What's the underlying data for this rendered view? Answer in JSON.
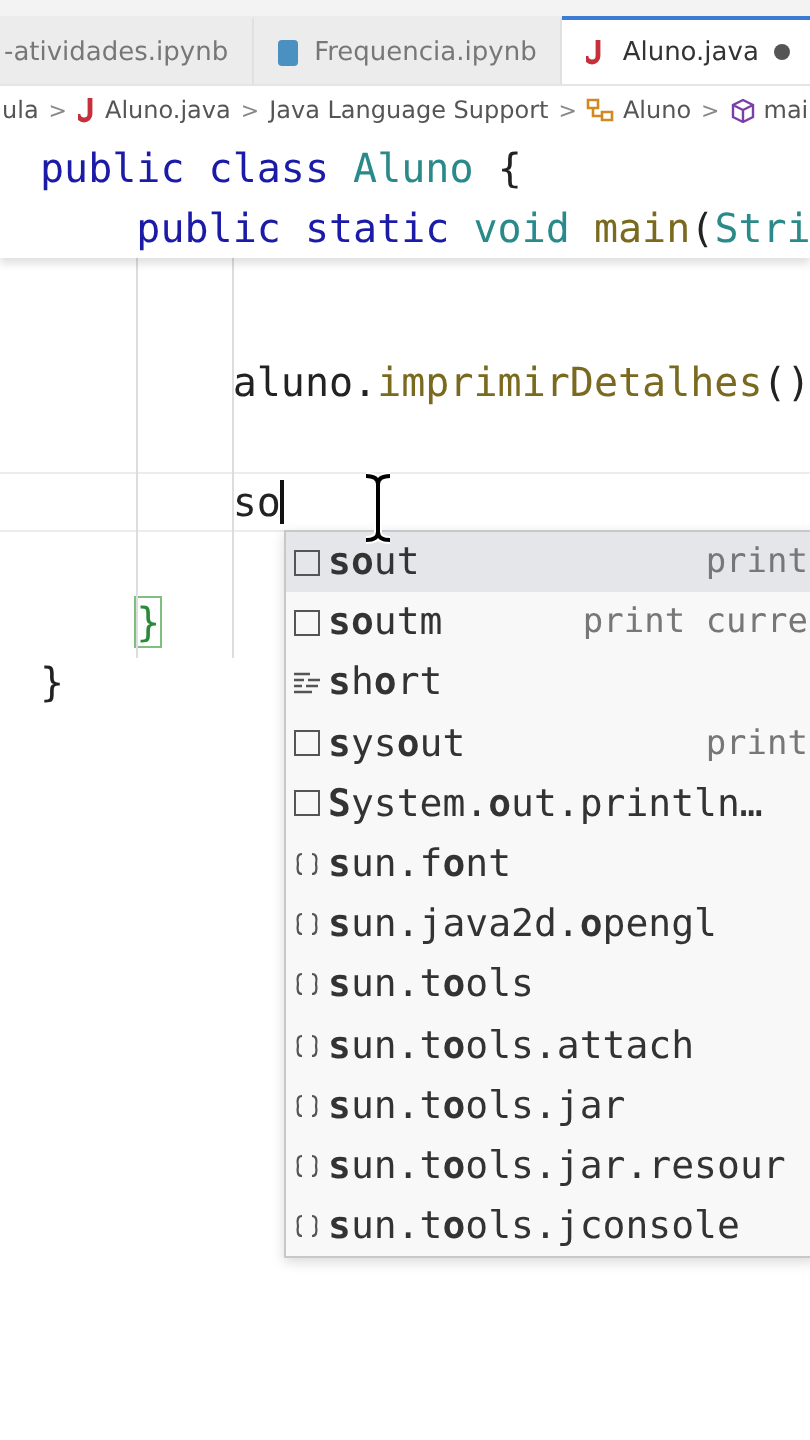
{
  "tabs": [
    {
      "label": "-atividades.ipynb",
      "kind": "plain",
      "selected": false,
      "modified": false
    },
    {
      "label": "Frequencia.ipynb",
      "kind": "notebook",
      "selected": false,
      "modified": false
    },
    {
      "label": "Aluno.java",
      "kind": "java",
      "selected": true,
      "modified": true
    }
  ],
  "breadcrumbs": [
    {
      "label": "ula",
      "kind": "plain"
    },
    {
      "separator": ">",
      "label": "Aluno.java",
      "kind": "java"
    },
    {
      "separator": ">",
      "label": "Java Language Support",
      "kind": "plain"
    },
    {
      "separator": ">",
      "label": "Aluno",
      "kind": "class"
    },
    {
      "separator": ">",
      "label": "mai",
      "kind": "method"
    }
  ],
  "sticky_lines": [
    {
      "tokens": [
        {
          "text": "public class ",
          "kind": "keyword"
        },
        {
          "text": "Aluno",
          "kind": "type"
        },
        {
          "text": " {",
          "kind": "plain"
        }
      ]
    },
    {
      "tokens": [
        {
          "text": "    public static ",
          "kind": "keyword"
        },
        {
          "text": "void ",
          "kind": "type"
        },
        {
          "text": "main",
          "kind": "method"
        },
        {
          "text": "(",
          "kind": "plain"
        },
        {
          "text": "Stri",
          "kind": "type"
        }
      ]
    }
  ],
  "code_lines": [
    {
      "kind": "normal"
    },
    {
      "kind": "normal",
      "tokens": [
        {
          "text": "        aluno.",
          "kind": "plain"
        },
        {
          "text": "imprimirDetalhes",
          "kind": "method"
        },
        {
          "text": "()",
          "kind": "plain"
        }
      ]
    },
    {
      "kind": "normal"
    },
    {
      "kind": "current",
      "tokens": [
        {
          "text": "        so",
          "kind": "plain"
        }
      ]
    },
    {
      "kind": "normal"
    },
    {
      "kind": "normal",
      "tokens": [
        {
          "text": "    }",
          "kind": "match"
        }
      ]
    },
    {
      "kind": "normal",
      "tokens": [
        {
          "text": "}",
          "kind": "plain"
        }
      ]
    }
  ],
  "suggestions": [
    {
      "kind": "snippet",
      "label": "**so**ut",
      "detail": "print",
      "selected": true
    },
    {
      "kind": "snippet",
      "label": "**so**utm",
      "detail": "print curre",
      "selected": false
    },
    {
      "kind": "keyword",
      "label": "**s**h**o**rt",
      "selected": false
    },
    {
      "kind": "snippet",
      "label": "**s**ys**o**ut",
      "detail": "print",
      "selected": false
    },
    {
      "kind": "snippet",
      "label": "**S**ystem.**o**ut.println…",
      "selected": false
    },
    {
      "kind": "module",
      "label": "**s**un.f**o**nt",
      "selected": false
    },
    {
      "kind": "module",
      "label": "**s**un.java2d.**o**pengl",
      "selected": false
    },
    {
      "kind": "module",
      "label": "**s**un.t**o**ols",
      "selected": false
    },
    {
      "kind": "module",
      "label": "**s**un.t**o**ols.attach",
      "selected": false
    },
    {
      "kind": "module",
      "label": "**s**un.t**o**ols.jar",
      "selected": false
    },
    {
      "kind": "module",
      "label": "**s**un.t**o**ols.jar.resour",
      "selected": false
    },
    {
      "kind": "module",
      "label": "**s**un.t**o**ols.jconsole",
      "selected": false
    }
  ]
}
